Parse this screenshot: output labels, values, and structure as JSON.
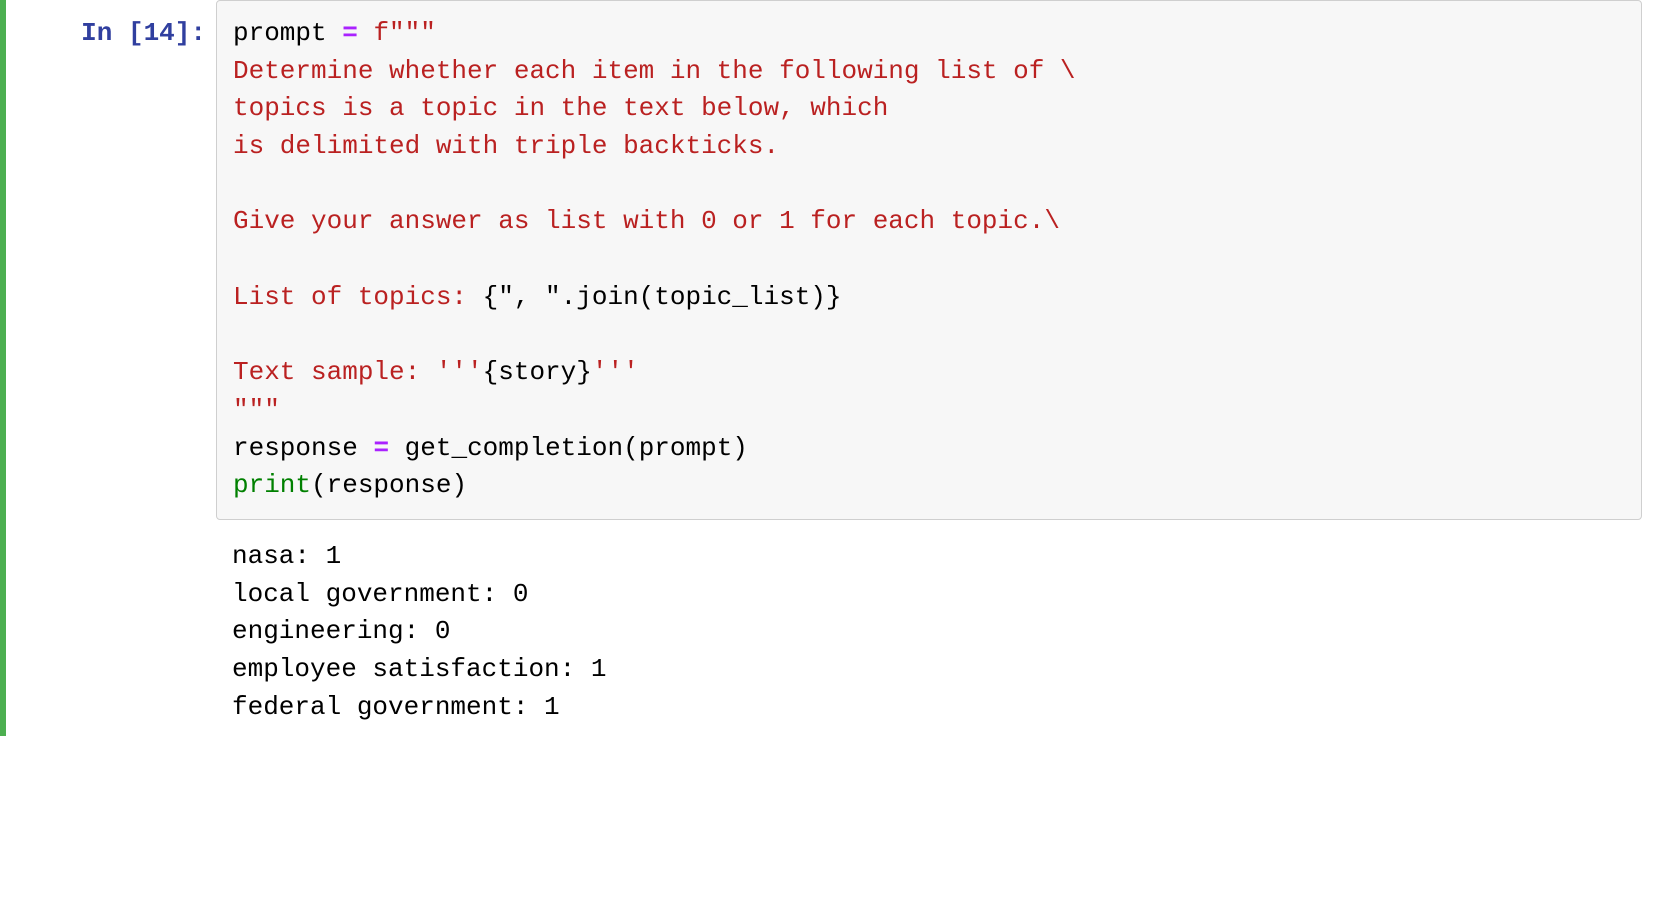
{
  "prompt": {
    "label": "In [14]:"
  },
  "code": {
    "line1_var": "prompt ",
    "line1_op": "= ",
    "line1_fprefix": "f",
    "line1_quote": "\"\"\"",
    "str_line2": "Determine whether each item in the following list of \\",
    "str_line3": "topics is a topic in the text below, which",
    "str_line4": "is delimited with triple backticks.",
    "str_line5": "",
    "str_line6": "Give your answer as list with 0 or 1 for each topic.\\",
    "str_line7": "",
    "str_line8_a": "List of topics: ",
    "str_line8_interp_open": "{",
    "str_line8_interp_content": "\", \".join(topic_list)",
    "str_line8_interp_close": "}",
    "str_line9": "",
    "str_line10_a": "Text sample: '''",
    "str_line10_interp_open": "{",
    "str_line10_interp_content": "story",
    "str_line10_interp_close": "}",
    "str_line10_b": "'''",
    "str_line11_quote": "\"\"\"",
    "line12_var": "response ",
    "line12_op": "= ",
    "line12_func": "get_completion(prompt)",
    "line13_print": "print",
    "line13_args": "(response)"
  },
  "output": {
    "line1": "nasa: 1",
    "line2": "local government: 0",
    "line3": "engineering: 0",
    "line4": "employee satisfaction: 1",
    "line5": "federal government: 1"
  }
}
